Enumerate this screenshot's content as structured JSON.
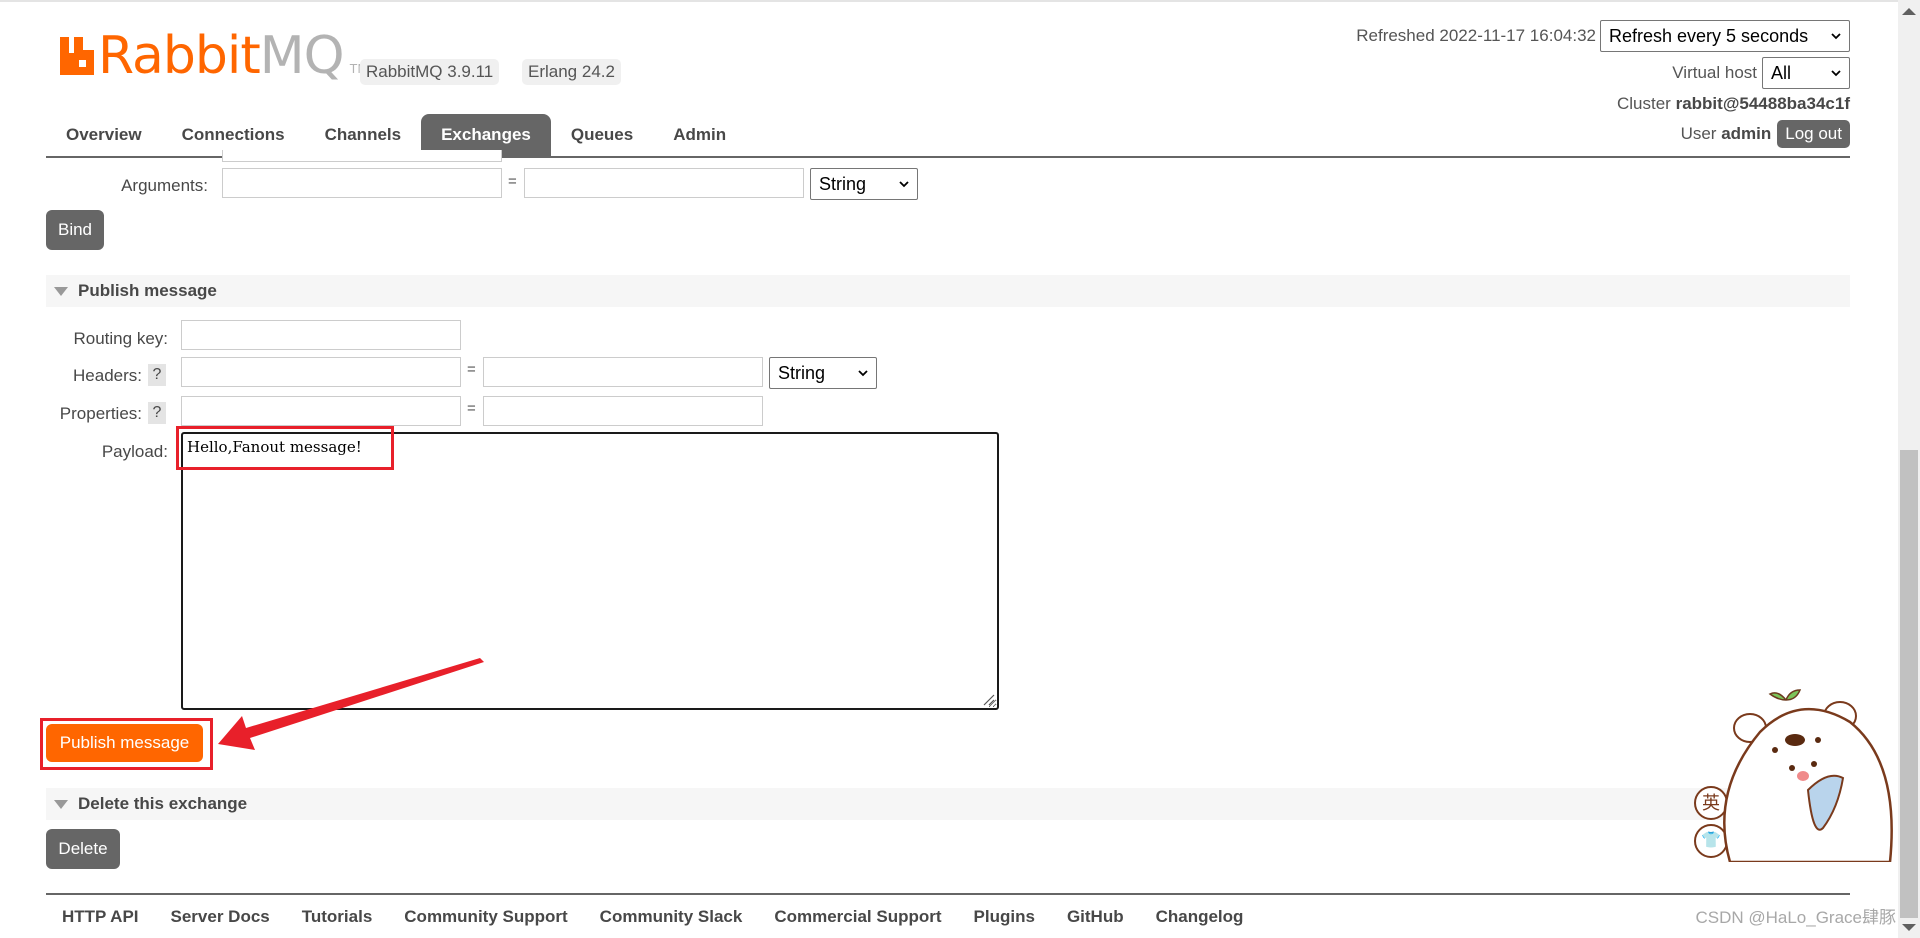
{
  "app": {
    "logo_text_primary": "Rabbit",
    "logo_text_secondary": "MQ",
    "logo_tm": "TM",
    "version_badges": [
      "RabbitMQ 3.9.11",
      "Erlang 24.2"
    ]
  },
  "header": {
    "refreshed_label": "Refreshed 2022-11-17 16:04:32",
    "refresh_select": {
      "selected": "Refresh every 5 seconds"
    },
    "virtual_host_label": "Virtual host",
    "virtual_host_select": {
      "selected": "All"
    },
    "cluster_label": "Cluster",
    "cluster_name": "rabbit@54488ba34c1f",
    "user_label": "User",
    "user_name": "admin",
    "logout_label": "Log out"
  },
  "tabs": [
    {
      "label": "Overview",
      "active": false
    },
    {
      "label": "Connections",
      "active": false
    },
    {
      "label": "Channels",
      "active": false
    },
    {
      "label": "Exchanges",
      "active": true
    },
    {
      "label": "Queues",
      "active": false
    },
    {
      "label": "Admin",
      "active": false
    }
  ],
  "bindings_form": {
    "arguments_label": "Arguments:",
    "arguments_key_value": "",
    "arguments_value_value": "",
    "equals": "=",
    "arguments_type": "String",
    "bind_label": "Bind"
  },
  "publish": {
    "section_title": "Publish message",
    "routing_key_label": "Routing key:",
    "routing_key_value": "",
    "headers_label": "Headers:",
    "headers_key_value": "",
    "headers_value_value": "",
    "headers_type": "String",
    "properties_label": "Properties:",
    "properties_key_value": "",
    "properties_value_value": "",
    "help_label": "?",
    "equals": "=",
    "payload_label": "Payload:",
    "payload_value": "Hello,Fanout message!",
    "publish_button_label": "Publish message"
  },
  "delete_section": {
    "section_title": "Delete this exchange",
    "delete_button_label": "Delete"
  },
  "footer": {
    "links": [
      "HTTP API",
      "Server Docs",
      "Tutorials",
      "Community Support",
      "Community Slack",
      "Commercial Support",
      "Plugins",
      "GitHub",
      "Changelog"
    ]
  },
  "overlay": {
    "watermark": "CSDN @HaLo_Grace肆豚",
    "ime_badge": "英",
    "annotation_color": "#e8202a"
  },
  "colors": {
    "brand_orange": "#ff6600",
    "tab_active_bg": "#666666",
    "section_bg": "#f6f6f6"
  }
}
